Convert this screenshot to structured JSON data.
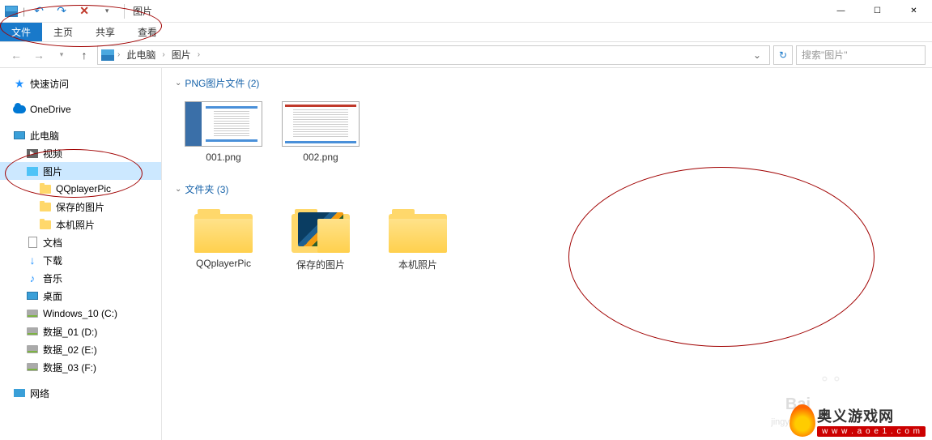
{
  "window": {
    "title": "图片",
    "minimize": "—",
    "maximize": "☐",
    "close": "✕"
  },
  "ribbon": {
    "file": "文件",
    "home": "主页",
    "share": "共享",
    "view": "查看"
  },
  "nav": {
    "back": "←",
    "forward": "→",
    "up": "↑"
  },
  "breadcrumb": {
    "root": "此电脑",
    "current": "图片"
  },
  "search": {
    "placeholder": "搜索\"图片\""
  },
  "sidebar": {
    "quick_access": "快速访问",
    "onedrive": "OneDrive",
    "this_pc": "此电脑",
    "videos": "视频",
    "pictures": "图片",
    "pic_children": [
      {
        "label": "QQplayerPic"
      },
      {
        "label": "保存的图片"
      },
      {
        "label": "本机照片"
      }
    ],
    "documents": "文档",
    "downloads": "下载",
    "music": "音乐",
    "desktop": "桌面",
    "drives": [
      {
        "label": "Windows_10 (C:)"
      },
      {
        "label": "数据_01 (D:)"
      },
      {
        "label": "数据_02 (E:)"
      },
      {
        "label": "数据_03 (F:)"
      }
    ],
    "network": "网络"
  },
  "content": {
    "group1": {
      "title": "PNG图片文件 (2)",
      "items": [
        {
          "name": "001.png"
        },
        {
          "name": "002.png"
        }
      ]
    },
    "group2": {
      "title": "文件夹 (3)",
      "items": [
        {
          "name": "QQplayerPic",
          "preview": false
        },
        {
          "name": "保存的图片",
          "preview": true
        },
        {
          "name": "本机照片",
          "preview": false
        }
      ]
    }
  },
  "watermark": {
    "site_cn": "奥义游戏网",
    "site_url": "w w w . a o e 1 . c o m",
    "baidu": "Bai",
    "jingyan": "jingya"
  }
}
